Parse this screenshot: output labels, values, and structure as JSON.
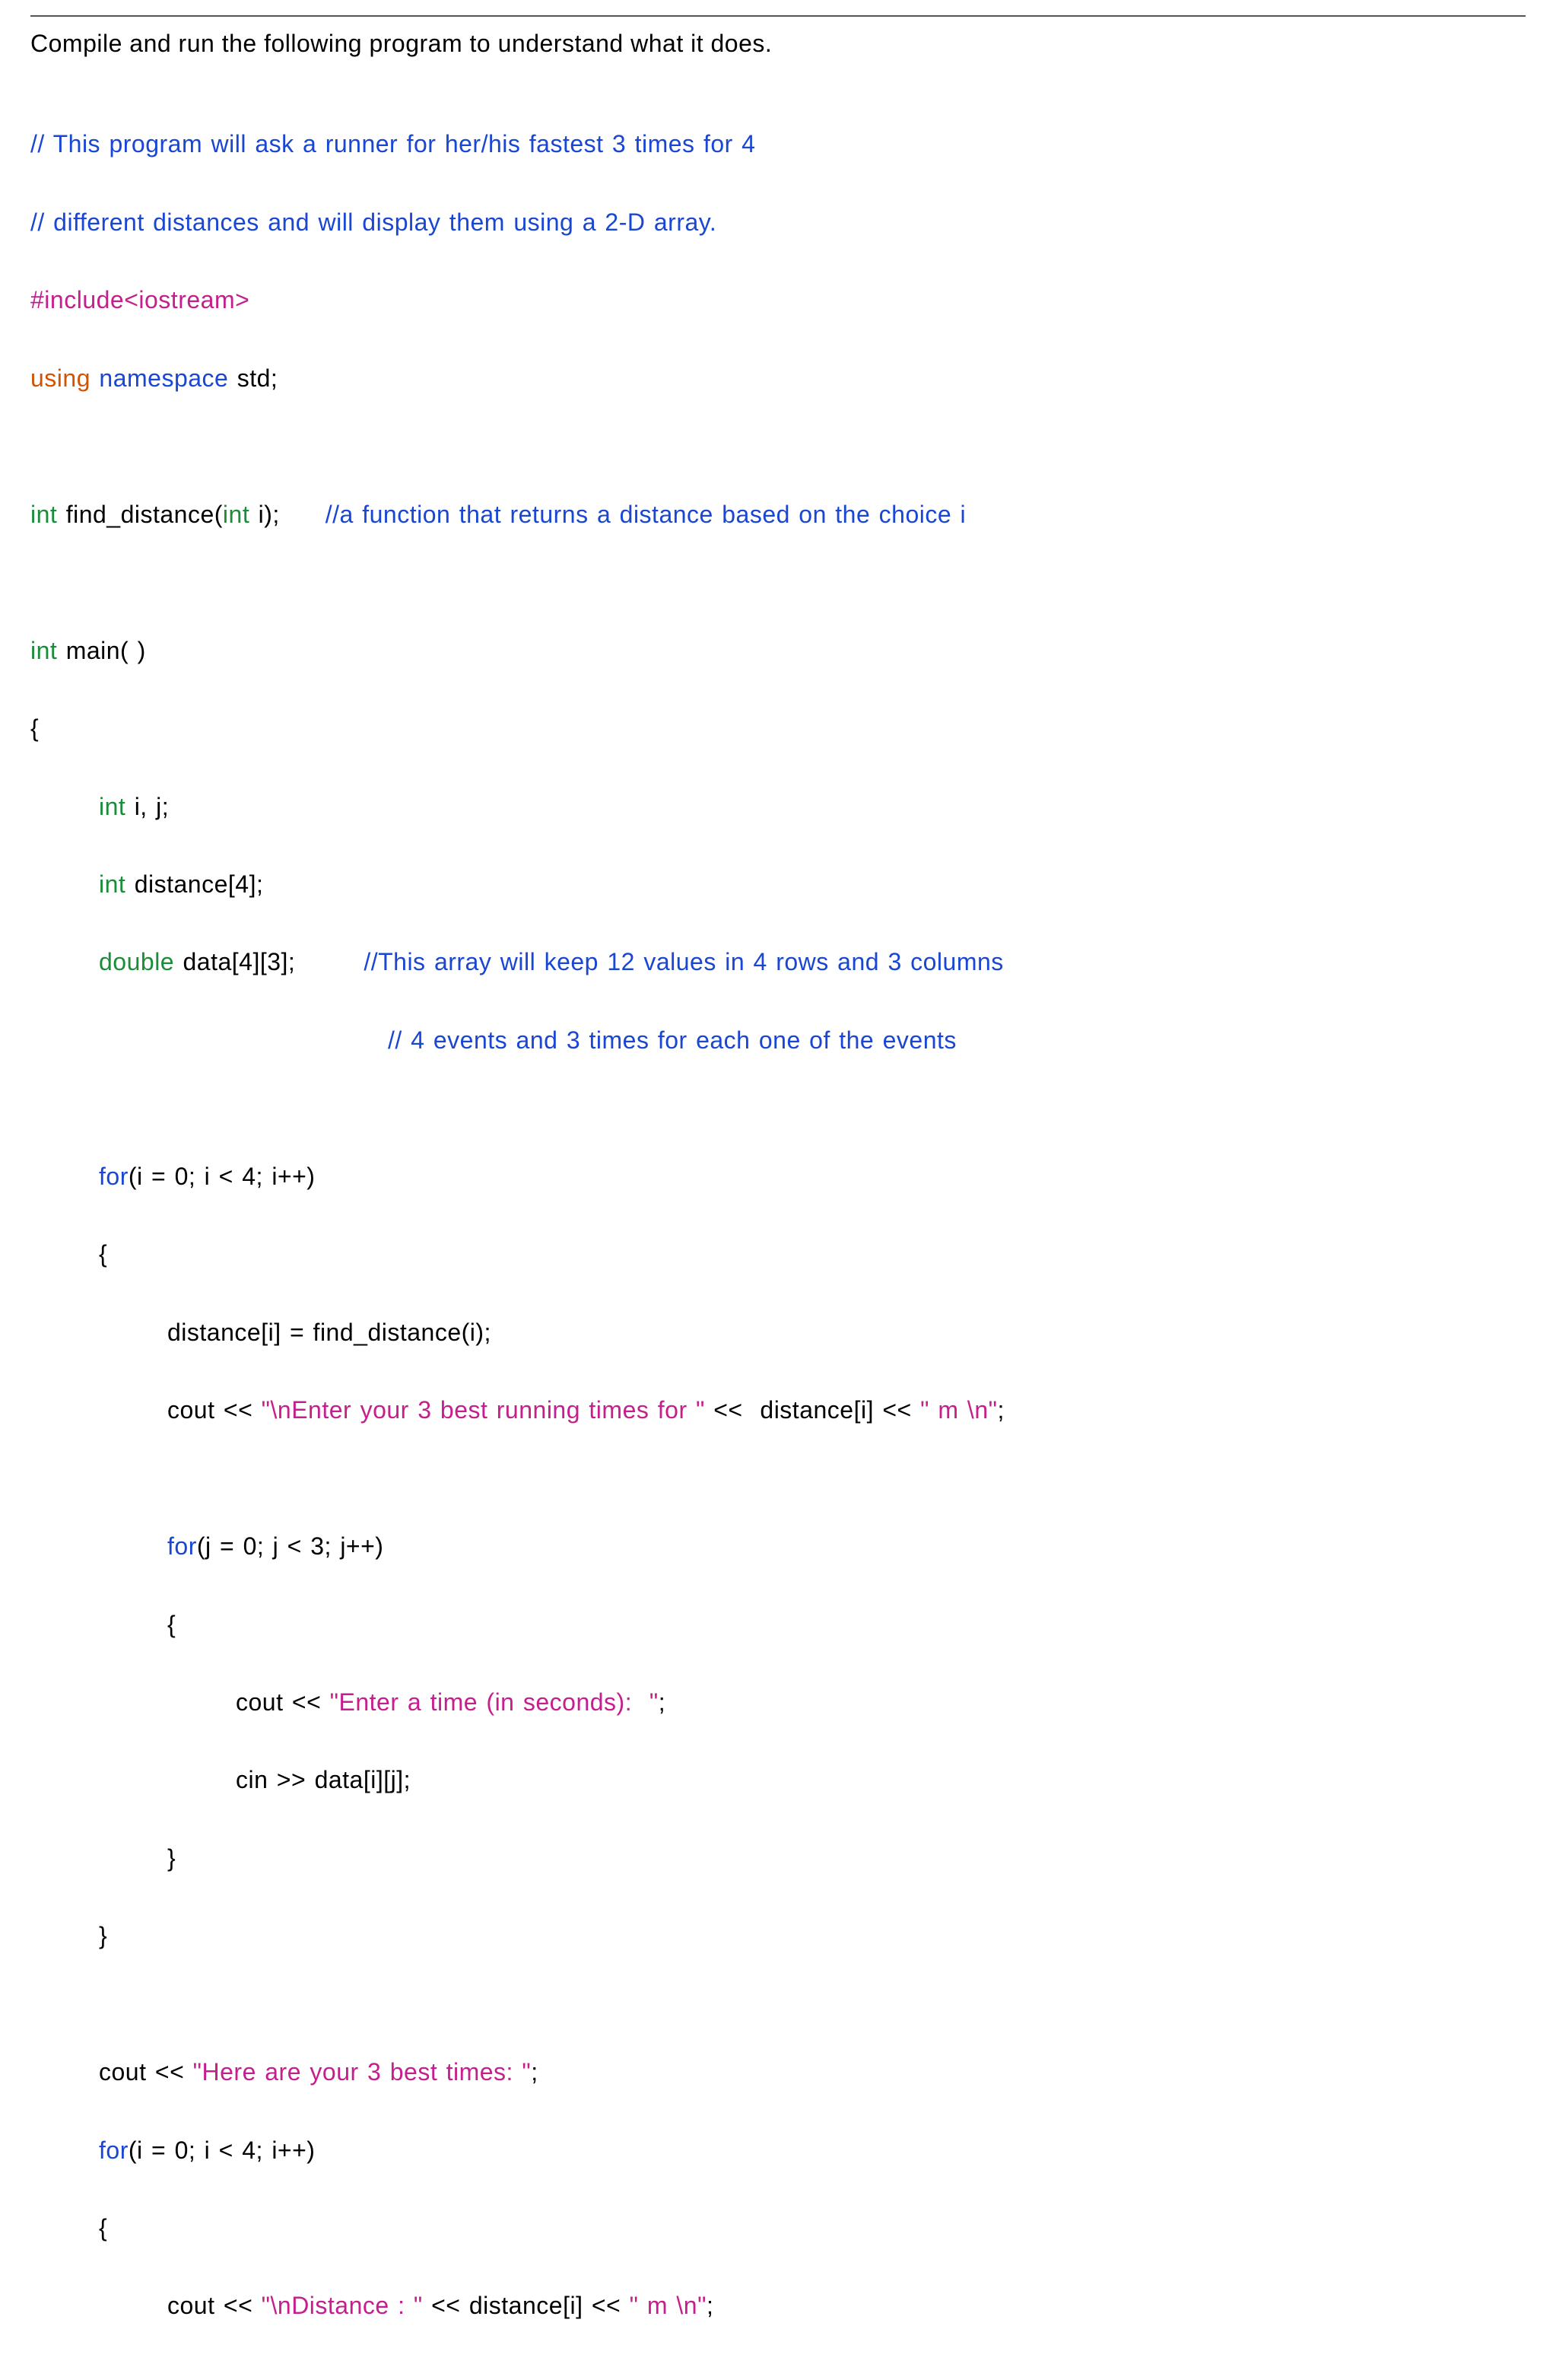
{
  "instruction": "Compile and run the following program to understand what it does.",
  "lines": {
    "c1": "// This program will ask a runner for her/his fastest 3 times for 4",
    "c2": "// different distances and will display them using a 2-D array.",
    "inc": "#include<iostream>",
    "using": "using",
    "namespace": "namespace",
    "std": "std;",
    "int1": "int",
    "find_dist": "find_distance(",
    "int2": "int",
    "find_dist_end": "i);",
    "find_dist_comment": "//a function that returns a distance based on the choice i",
    "int3": "int",
    "main": "main( )",
    "brace_open": "{",
    "int4": "int",
    "ij": "i, j;",
    "int5": "int",
    "distance_decl": "distance[4];",
    "double": "double",
    "data_decl": "data[4][3];",
    "data_comment1": "//This array will keep 12 values in 4 rows and 3 columns",
    "data_comment2": "// 4 events and 3 times for each one of the events",
    "for1": "for",
    "for1_cond": "(i = 0; i < 4; i++)",
    "brace_open2": "{",
    "dist_assign": "distance[i] = find_distance(i);",
    "cout1a": "cout <<",
    "cout1_str1": "\"\\nEnter your 3 best running times for \"",
    "cout1_mid": "<<  distance[i] <<",
    "cout1_str2": "\" m \\n\"",
    "cout1_end": ";",
    "for2": "for",
    "for2_cond": "(j = 0; j < 3; j++)",
    "brace_open3": "{",
    "cout2a": "cout <<",
    "cout2_str": "\"Enter a time (in seconds):  \"",
    "cout2_end": ";",
    "cin": "cin >> data[i][j];",
    "brace_close3": "}",
    "brace_close2": "}",
    "cout3a": "cout <<",
    "cout3_str": "\"Here are your 3 best times: \"",
    "cout3_end": ";",
    "for3": "for",
    "for3_cond": "(i = 0; i < 4; i++)",
    "brace_open4": "{",
    "cout4a": "cout <<",
    "cout4_str1": "\"\\nDistance : \"",
    "cout4_mid": "<< distance[i] <<",
    "cout4_str2": "\" m \\n\"",
    "cout4_end": ";"
  }
}
